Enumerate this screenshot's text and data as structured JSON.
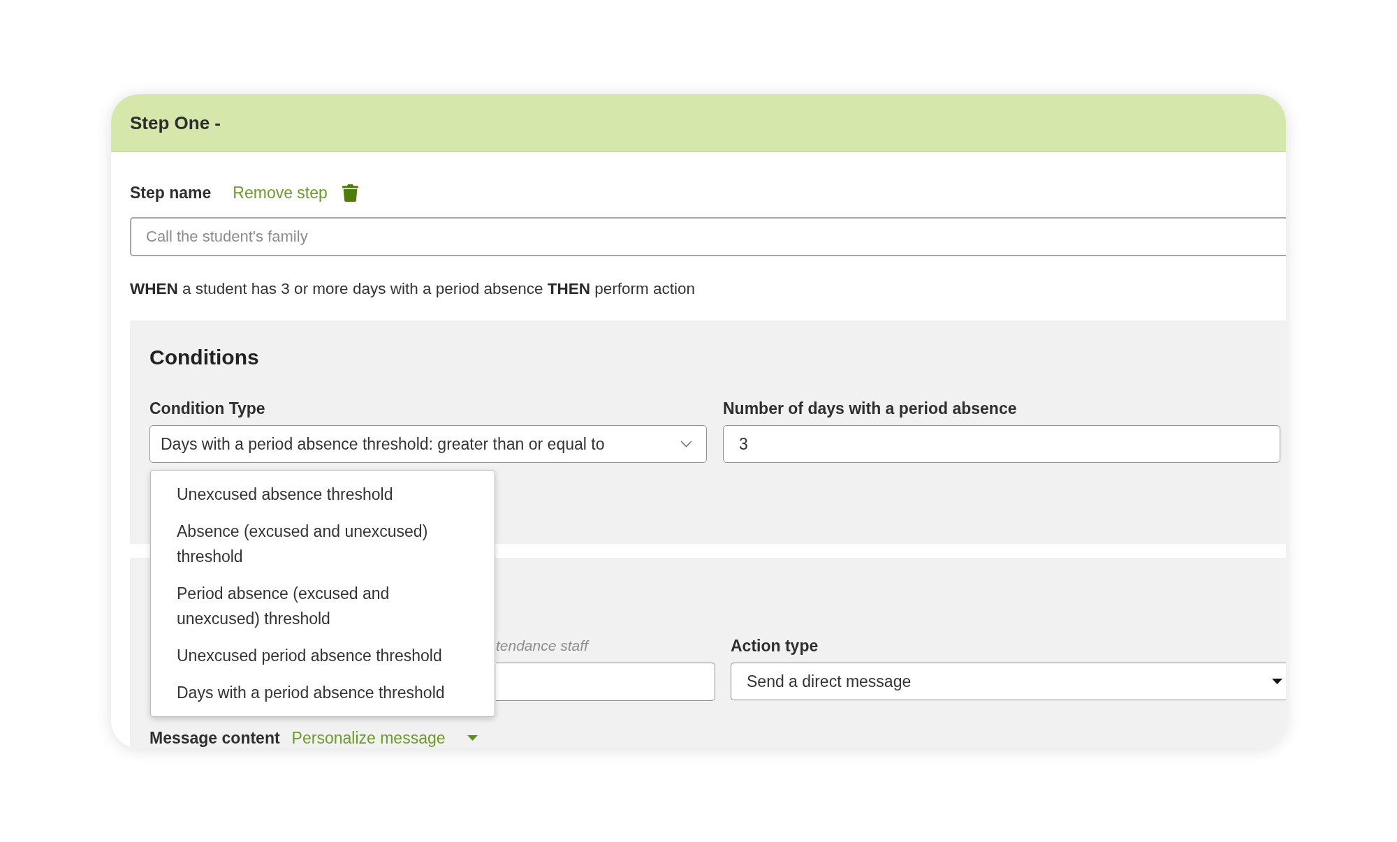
{
  "step": {
    "title": "Step One -",
    "step_name": {
      "label": "Step name",
      "remove_action": "Remove step",
      "placeholder": "Call the student's family"
    },
    "rule_summary": "**WHEN** a student has 3 or more days with a period absence **THEN** perform action",
    "conditions": {
      "heading": "Conditions",
      "condition_type": {
        "label": "Condition Type",
        "value": "Days with a period absence threshold: greater than or equal to",
        "expanded": true,
        "options": [
          {
            "label": "Unexcused absence threshold",
            "selected": false
          },
          {
            "label": "Absence (excused and unexcused) threshold",
            "selected": false
          },
          {
            "label": "Period absence (excused and unexcused) threshold",
            "selected": false
          },
          {
            "label": "Unexcused period absence threshold",
            "selected": false
          },
          {
            "label": "Days with a period absence threshold",
            "selected": false
          }
        ]
      },
      "count_field": {
        "label": "Number of days with a period absence",
        "value": "3"
      }
    },
    "actions": {
      "field_1": {
        "note": "tendance staff"
      },
      "action_type": {
        "label": "Action type",
        "value": "Send a direct message"
      },
      "message_content": {
        "label": "Message content",
        "personalize_action": "Personalize message"
      }
    }
  }
}
